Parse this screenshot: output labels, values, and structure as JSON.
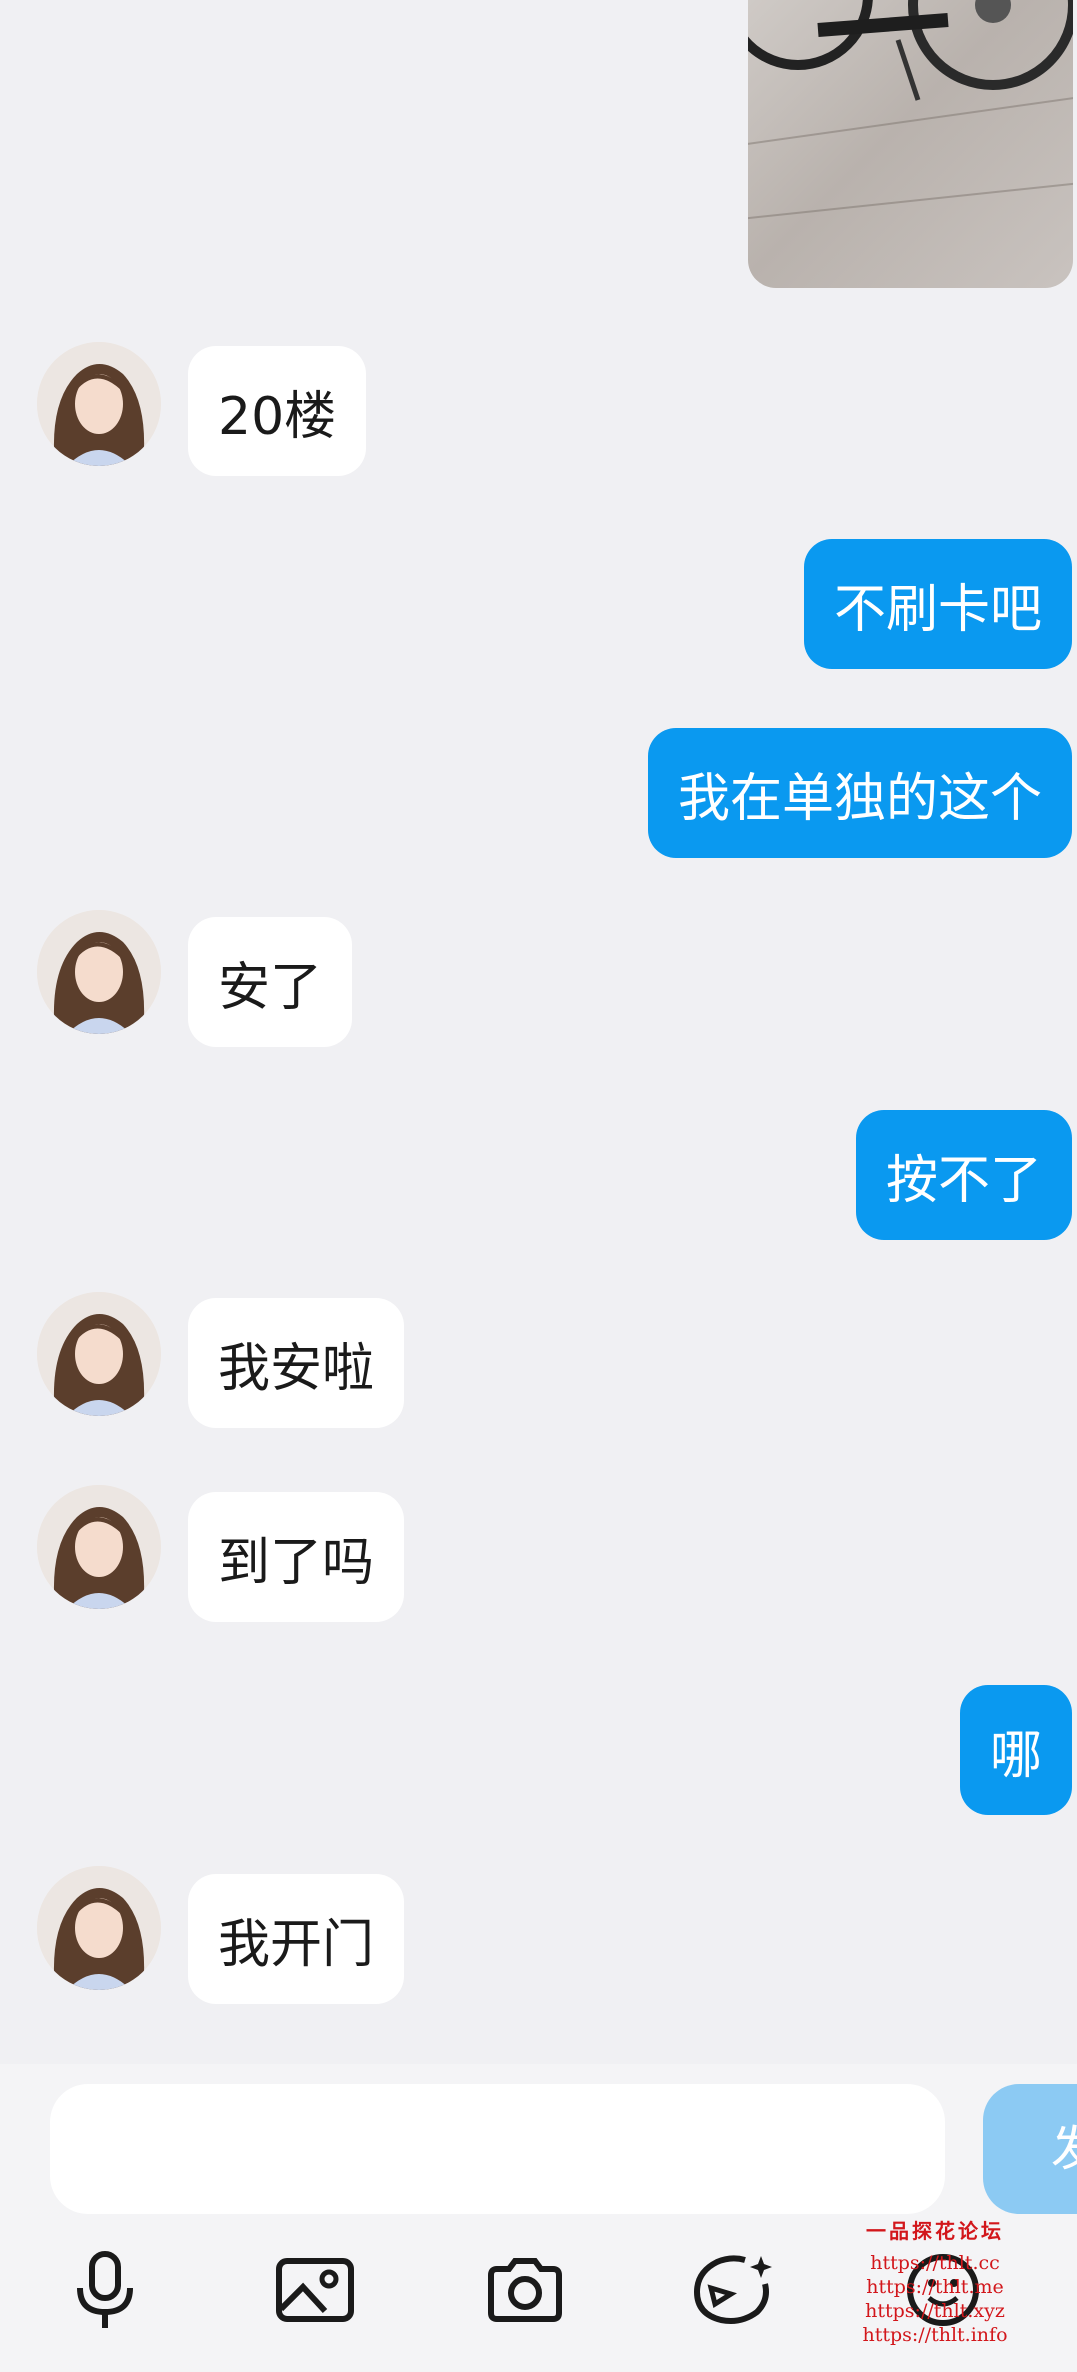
{
  "colors": {
    "outgoing_bubble": "#0a99f0",
    "incoming_bubble": "#ffffff",
    "send_button": "#8ccaf3"
  },
  "messages": [
    {
      "side": "in",
      "text": "20楼"
    },
    {
      "side": "out",
      "text": "不刷卡吧"
    },
    {
      "side": "out",
      "text": "我在单独的这个"
    },
    {
      "side": "in",
      "text": "安了"
    },
    {
      "side": "out",
      "text": "按不了"
    },
    {
      "side": "in",
      "text": "我安啦"
    },
    {
      "side": "in",
      "text": "到了吗"
    },
    {
      "side": "out",
      "text": "哪"
    },
    {
      "side": "in",
      "text": "我开门"
    }
  ],
  "composer": {
    "send_label": "发",
    "placeholder": ""
  },
  "toolbar": [
    "microphone-icon",
    "image-icon",
    "camera-icon",
    "sticker-icon",
    "emoji-icon"
  ],
  "watermark": {
    "title": "一品探花论坛",
    "lines": [
      "https://thlt.cc",
      "https://thlt.me",
      "https://thlt.xyz",
      "https://thlt.info"
    ]
  }
}
